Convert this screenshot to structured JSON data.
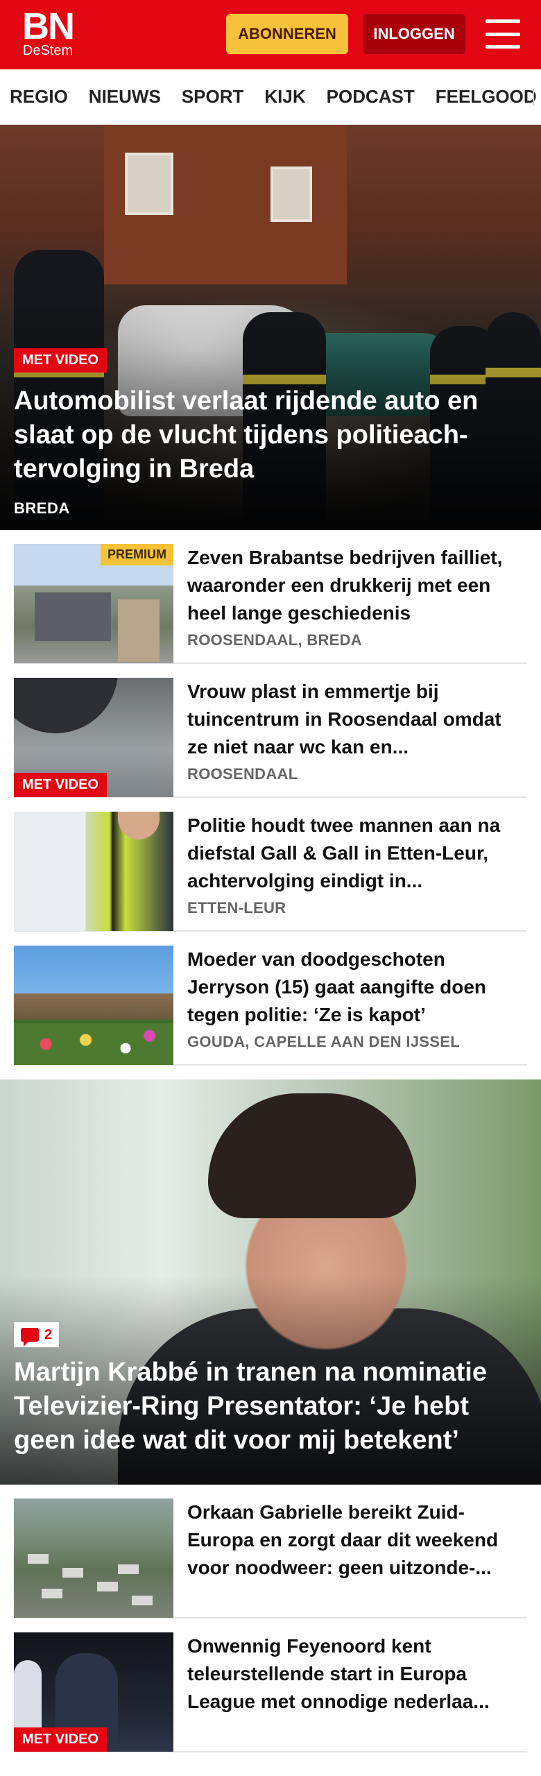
{
  "header": {
    "logo_main": "BN",
    "logo_sub": "DeStem",
    "subscribe_label": "ABONNEREN",
    "login_label": "INLOGGEN",
    "menu_icon": "hamburger-icon",
    "brand_color": "#e30613",
    "subscribe_color": "#f7c23a"
  },
  "nav": {
    "items": [
      "REGIO",
      "NIEUWS",
      "SPORT",
      "KIJK",
      "PODCAST",
      "FEELGOOD"
    ]
  },
  "hero": {
    "badge": "MET VIDEO",
    "title": "Automobilist verlaat rijdende auto en slaat op de vlucht tijdens politieach­tervolging in Breda",
    "location": "BREDA"
  },
  "articles": [
    {
      "title": "Zeven Brabantse bedrijven failliet, waaronder een drukkerij met een heel lange geschiedenis",
      "location": "ROOSENDAAL, BREDA",
      "premium": "PREMIUM"
    },
    {
      "title": "Vrouw plast in emmertje bij tuincentrum in Roosendaal omdat ze niet naar wc kan en...",
      "location": "ROOSENDAAL",
      "badge": "MET VIDEO"
    },
    {
      "title": "Politie houdt twee mannen aan na diefstal Gall & Gall in Etten-Leur, achtervolging eindigt in...",
      "location": "ETTEN-LEUR"
    },
    {
      "title": "Moeder van doodgeschoten Jerryson (15) gaat aangifte doen tegen politie: ‘Ze is kapot’",
      "location": "GOUDA, CAPELLE AAN DEN IJSSEL"
    }
  ],
  "feature": {
    "comment_count": "2",
    "title": "Martijn Krabbé in tranen na nominatie Televizier-Ring Presentator: ‘Je hebt geen idee wat dit voor mij betekent’"
  },
  "more_articles": [
    {
      "title": "Orkaan Gabrielle bereikt Zuid-Europa en zorgt daar dit weekend voor noodweer: geen uitzonde-..."
    },
    {
      "title": "Onwennig Feyenoord kent teleurstellende start in Europa League met onnodige nederlaa...",
      "badge": "MET VIDEO"
    }
  ]
}
